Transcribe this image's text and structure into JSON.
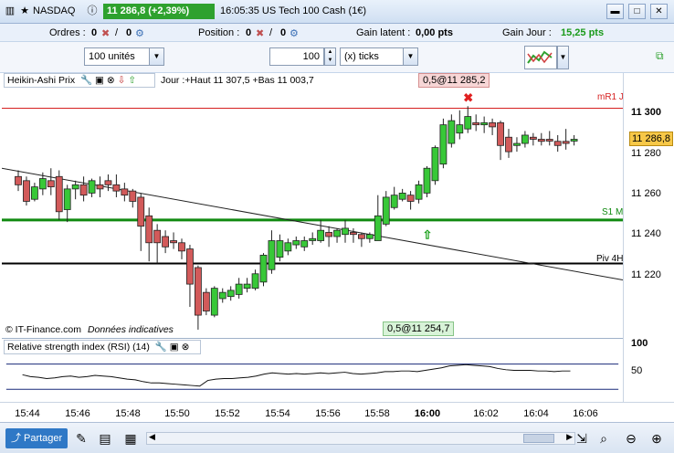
{
  "title_bar": {
    "instrument": "NASDAQ",
    "price_badge": "11 286,8 (+2,39%)",
    "time_title": "16:05:35 US Tech 100 Cash (1€)"
  },
  "order_bar": {
    "orders_label": "Ordres :",
    "orders_value": "0",
    "orders_value2": "0",
    "position_label": "Position :",
    "position_value": "0",
    "position_value2": "0",
    "gain_latent_label": "Gain latent :",
    "gain_latent_value": "0,00 pts",
    "gain_jour_label": "Gain Jour :",
    "gain_jour_value": "15,25 pts"
  },
  "toolbar": {
    "units_select": "100 unités",
    "quantity": "100",
    "ticks_select": "(x) ticks"
  },
  "indicator_bar": {
    "name": "Heikin-Ashi Prix",
    "day_info": "Jour :+Haut 11 307,5 +Bas 11 003,7"
  },
  "annotations": {
    "top_order": "0,5@11 285,2",
    "bottom_order": "0,5@11 254,7",
    "mr1": "mR1 J",
    "s1": "S1 M",
    "piv": "Piv 4H",
    "copyright": "© IT-Finance.com",
    "indicative": "Données indicatives"
  },
  "price_axis": {
    "labels": [
      "11 300",
      "11 280",
      "11 260",
      "11 240",
      "11 220"
    ],
    "current": "11 286,8"
  },
  "rsi": {
    "label": "Relative strength index (RSI) (14)",
    "axis_labels": [
      "100",
      "50"
    ]
  },
  "time_axis": [
    "15:44",
    "15:46",
    "15:48",
    "15:50",
    "15:52",
    "15:54",
    "15:56",
    "15:58",
    "16:00",
    "16:02",
    "16:04",
    "16:06"
  ],
  "bottom_bar": {
    "share_label": "Partager"
  },
  "colors": {
    "up": "#38c838",
    "down": "#d25a5a",
    "badge": "#2ea12e",
    "mr1": "#d62020",
    "s1": "#108a10",
    "piv": "#000000"
  },
  "chart_data": {
    "type": "candlestick-heikin-ashi",
    "y_range": [
      11190,
      11318
    ],
    "candles": [
      {
        "o": 11264,
        "c": 11268,
        "h": 11271,
        "l": 11261,
        "up": false
      },
      {
        "o": 11266,
        "c": 11256,
        "h": 11268,
        "l": 11254,
        "up": false
      },
      {
        "o": 11257,
        "c": 11263,
        "h": 11265,
        "l": 11256,
        "up": true
      },
      {
        "o": 11262,
        "c": 11267,
        "h": 11270,
        "l": 11259,
        "up": true
      },
      {
        "o": 11266,
        "c": 11263,
        "h": 11272,
        "l": 11259,
        "up": false
      },
      {
        "o": 11268,
        "c": 11251,
        "h": 11271,
        "l": 11247,
        "up": false
      },
      {
        "o": 11252,
        "c": 11262,
        "h": 11264,
        "l": 11246,
        "up": true
      },
      {
        "o": 11262,
        "c": 11264,
        "h": 11266,
        "l": 11257,
        "up": true
      },
      {
        "o": 11264,
        "c": 11259,
        "h": 11268,
        "l": 11256,
        "up": false
      },
      {
        "o": 11260,
        "c": 11266,
        "h": 11267,
        "l": 11258,
        "up": true
      },
      {
        "o": 11264,
        "c": 11262,
        "h": 11268,
        "l": 11258,
        "up": false
      },
      {
        "o": 11266,
        "c": 11264,
        "h": 11269,
        "l": 11261,
        "up": false
      },
      {
        "o": 11264,
        "c": 11261,
        "h": 11269,
        "l": 11258,
        "up": false
      },
      {
        "o": 11262,
        "c": 11259,
        "h": 11265,
        "l": 11256,
        "up": false
      },
      {
        "o": 11261,
        "c": 11256,
        "h": 11262,
        "l": 11253,
        "up": false
      },
      {
        "o": 11258,
        "c": 11244,
        "h": 11260,
        "l": 11232,
        "up": false
      },
      {
        "o": 11249,
        "c": 11236,
        "h": 11253,
        "l": 11227,
        "up": false
      },
      {
        "o": 11242,
        "c": 11236,
        "h": 11245,
        "l": 11226,
        "up": false
      },
      {
        "o": 11239,
        "c": 11234,
        "h": 11242,
        "l": 11231,
        "up": false
      },
      {
        "o": 11237,
        "c": 11236,
        "h": 11241,
        "l": 11233,
        "up": false
      },
      {
        "o": 11236,
        "c": 11232,
        "h": 11238,
        "l": 11228,
        "up": false
      },
      {
        "o": 11233,
        "c": 11216,
        "h": 11235,
        "l": 11205,
        "up": false
      },
      {
        "o": 11224,
        "c": 11201,
        "h": 11225,
        "l": 11194,
        "up": false
      },
      {
        "o": 11212,
        "c": 11203,
        "h": 11214,
        "l": 11201,
        "up": false
      },
      {
        "o": 11201,
        "c": 11214,
        "h": 11215,
        "l": 11200,
        "up": true
      },
      {
        "o": 11209,
        "c": 11212,
        "h": 11214,
        "l": 11207,
        "up": true
      },
      {
        "o": 11210,
        "c": 11213,
        "h": 11215,
        "l": 11208,
        "up": true
      },
      {
        "o": 11211,
        "c": 11216,
        "h": 11219,
        "l": 11209,
        "up": true
      },
      {
        "o": 11214,
        "c": 11216,
        "h": 11219,
        "l": 11212,
        "up": true
      },
      {
        "o": 11214,
        "c": 11221,
        "h": 11223,
        "l": 11213,
        "up": true
      },
      {
        "o": 11217,
        "c": 11230,
        "h": 11231,
        "l": 11215,
        "up": true
      },
      {
        "o": 11223,
        "c": 11237,
        "h": 11242,
        "l": 11221,
        "up": true
      },
      {
        "o": 11229,
        "c": 11237,
        "h": 11240,
        "l": 11227,
        "up": true
      },
      {
        "o": 11232,
        "c": 11236,
        "h": 11238,
        "l": 11230,
        "up": true
      },
      {
        "o": 11235,
        "c": 11237,
        "h": 11239,
        "l": 11233,
        "up": true
      },
      {
        "o": 11234,
        "c": 11237,
        "h": 11239,
        "l": 11232,
        "up": true
      },
      {
        "o": 11237,
        "c": 11238,
        "h": 11241,
        "l": 11235,
        "up": true
      },
      {
        "o": 11237,
        "c": 11242,
        "h": 11247,
        "l": 11236,
        "up": true
      },
      {
        "o": 11241,
        "c": 11239,
        "h": 11244,
        "l": 11234,
        "up": false
      },
      {
        "o": 11239,
        "c": 11242,
        "h": 11243,
        "l": 11236,
        "up": true
      },
      {
        "o": 11240,
        "c": 11243,
        "h": 11247,
        "l": 11236,
        "up": true
      },
      {
        "o": 11241,
        "c": 11240,
        "h": 11243,
        "l": 11236,
        "up": false
      },
      {
        "o": 11240,
        "c": 11238,
        "h": 11241,
        "l": 11234,
        "up": false
      },
      {
        "o": 11238,
        "c": 11240,
        "h": 11241,
        "l": 11236,
        "up": true
      },
      {
        "o": 11237,
        "c": 11249,
        "h": 11259,
        "l": 11237,
        "up": true
      },
      {
        "o": 11245,
        "c": 11258,
        "h": 11261,
        "l": 11244,
        "up": true
      },
      {
        "o": 11253,
        "c": 11259,
        "h": 11263,
        "l": 11252,
        "up": true
      },
      {
        "o": 11257,
        "c": 11260,
        "h": 11262,
        "l": 11256,
        "up": true
      },
      {
        "o": 11259,
        "c": 11256,
        "h": 11261,
        "l": 11252,
        "up": false
      },
      {
        "o": 11257,
        "c": 11264,
        "h": 11266,
        "l": 11255,
        "up": true
      },
      {
        "o": 11260,
        "c": 11272,
        "h": 11273,
        "l": 11258,
        "up": true
      },
      {
        "o": 11266,
        "c": 11282,
        "h": 11283,
        "l": 11264,
        "up": true
      },
      {
        "o": 11274,
        "c": 11293,
        "h": 11296,
        "l": 11272,
        "up": true
      },
      {
        "o": 11284,
        "c": 11295,
        "h": 11298,
        "l": 11282,
        "up": true
      },
      {
        "o": 11289,
        "c": 11293,
        "h": 11300,
        "l": 11286,
        "up": true
      },
      {
        "o": 11291,
        "c": 11297,
        "h": 11302,
        "l": 11289,
        "up": true
      },
      {
        "o": 11294,
        "c": 11293,
        "h": 11298,
        "l": 11290,
        "up": false
      },
      {
        "o": 11293,
        "c": 11294,
        "h": 11297,
        "l": 11289,
        "up": true
      },
      {
        "o": 11294,
        "c": 11292,
        "h": 11296,
        "l": 11288,
        "up": false
      },
      {
        "o": 11294,
        "c": 11283,
        "h": 11295,
        "l": 11276,
        "up": false
      },
      {
        "o": 11287,
        "c": 11280,
        "h": 11291,
        "l": 11277,
        "up": false
      },
      {
        "o": 11283,
        "c": 11284,
        "h": 11287,
        "l": 11280,
        "up": true
      },
      {
        "o": 11284,
        "c": 11288,
        "h": 11290,
        "l": 11282,
        "up": true
      },
      {
        "o": 11287,
        "c": 11286,
        "h": 11289,
        "l": 11283,
        "up": false
      },
      {
        "o": 11286,
        "c": 11285,
        "h": 11289,
        "l": 11283,
        "up": false
      },
      {
        "o": 11286,
        "c": 11286,
        "h": 11290,
        "l": 11283,
        "up": false
      },
      {
        "o": 11285,
        "c": 11283,
        "h": 11288,
        "l": 11280,
        "up": false
      },
      {
        "o": 11284,
        "c": 11285,
        "h": 11291,
        "l": 11281,
        "up": false
      },
      {
        "o": 11286,
        "c": 11286,
        "h": 11288,
        "l": 11283,
        "up": true
      }
    ],
    "levels": {
      "mR1": 11301,
      "S1": 11247,
      "Piv": 11226
    },
    "trendline": [
      [
        11272,
        11218
      ]
    ],
    "rsi_values": [
      53,
      50,
      49,
      47,
      48,
      50,
      51,
      49,
      50,
      52,
      51,
      50,
      48,
      46,
      45,
      42,
      40,
      40,
      39,
      38,
      37,
      36,
      35,
      44,
      46,
      47,
      47,
      48,
      49,
      51,
      54,
      56,
      55,
      54,
      55,
      54,
      55,
      56,
      55,
      56,
      57,
      55,
      54,
      55,
      56,
      58,
      58,
      59,
      59,
      58,
      60,
      62,
      64,
      67,
      68,
      69,
      68,
      67,
      66,
      63,
      61,
      60,
      60,
      60,
      59,
      59,
      58,
      59,
      59
    ]
  }
}
